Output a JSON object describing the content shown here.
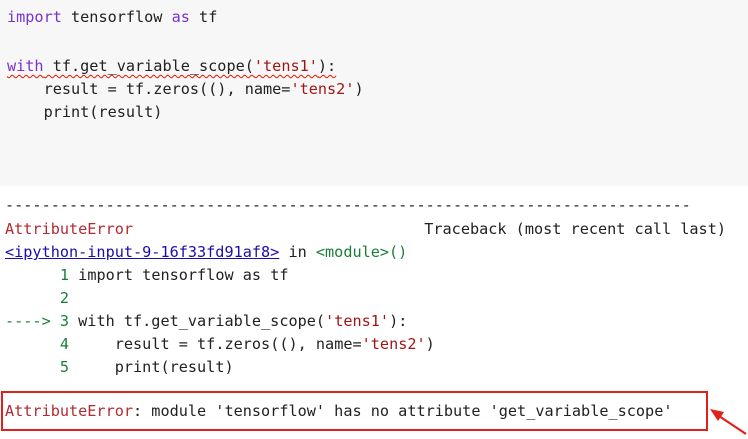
{
  "code_cell": {
    "line1": {
      "kw1": "import",
      "mod": " tensorflow ",
      "kw2": "as",
      "alias": " tf"
    },
    "line3": {
      "kw": "with",
      "call": " tf.get_variable_scope(",
      "arg": "'tens1'",
      "end": "):"
    },
    "line4": {
      "pre": "    result = tf.zeros((), name=",
      "arg": "'tens2'",
      "end": ")"
    },
    "line5": {
      "text": "    print(result)"
    }
  },
  "output": {
    "separator": "---------------------------------------------------------------------------",
    "error_name": "AttributeError",
    "traceback_label": "Traceback (most recent call last)",
    "input_link": "<ipython-input-9-16f33fd91af8>",
    "in_word": " in ",
    "module_text": "<module>()",
    "trace_lines": [
      {
        "marker": "      ",
        "num": "1",
        "code": " import tensorflow as tf"
      },
      {
        "marker": "      ",
        "num": "2",
        "code": ""
      },
      {
        "marker": "---->",
        "num": " 3",
        "code": " with tf.get_variable_scope(",
        "str": "'tens1'",
        "end": "):"
      },
      {
        "marker": "      ",
        "num": "4",
        "code": "     result = tf.zeros((), name=",
        "str": "'tens2'",
        "end": ")"
      },
      {
        "marker": "      ",
        "num": "5",
        "code": "     print(result)"
      }
    ],
    "final_error_name": "AttributeError",
    "final_error_msg": ": module 'tensorflow' has no attribute 'get_variable_scope'"
  },
  "colors": {
    "keyword": "#7b30d0",
    "string": "#a31515",
    "error": "#b22b31",
    "highlight": "#e0201b"
  },
  "icons": [
    "red-arrow-annotation-icon"
  ]
}
